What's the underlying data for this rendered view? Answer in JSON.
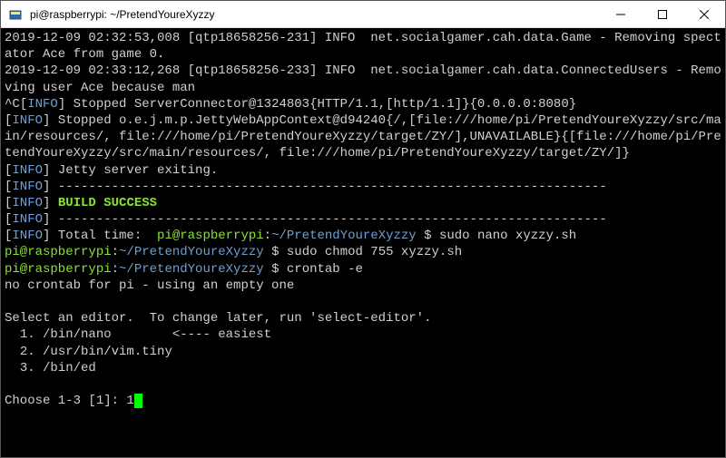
{
  "titlebar": {
    "title": "pi@raspberrypi: ~/PretendYoureXyzzy"
  },
  "term": {
    "l1": "2019-12-09 02:32:53,008 [qtp18658256-231] INFO  net.socialgamer.cah.data.Game - Removing spectator Ace from game 0.",
    "l2": "2019-12-09 02:33:12,268 [qtp18658256-233] INFO  net.socialgamer.cah.data.ConnectedUsers - Removing user Ace because man",
    "ctrlc": "^C",
    "bracket_open": "[",
    "bracket_close": "]",
    "info": "INFO",
    "stopped1": " Stopped ServerConnector@1324803{HTTP/1.1,[http/1.1]}{0.0.0.0:8080}",
    "stopped2": " Stopped o.e.j.m.p.JettyWebAppContext@d94240{/,[file:///home/pi/PretendYoureXyzzy/src/main/resources/, file:///home/pi/PretendYoureXyzzy/target/ZY/],UNAVAILABLE}{[file:///home/pi/PretendYoureXyzzy/src/main/resources/, file:///home/pi/PretendYoureXyzzy/target/ZY/]}",
    "jettyexit": " Jetty server exiting.",
    "dashes": " ------------------------------------------------------------------------",
    "buildsuccess": "BUILD SUCCESS",
    "totaltime_prefix": " Total time:  ",
    "prompt_user": "pi@raspberrypi",
    "prompt_sep": ":",
    "prompt_path": "~/PretendYoureXyzzy",
    "prompt_end": " $ ",
    "cmd1": "sudo nano xyzzy.sh",
    "cmd2": "sudo chmod 755 xyzzy.sh",
    "cmd3": "crontab -e",
    "nocrontab": "no crontab for pi - using an empty one",
    "selecteditor": "Select an editor.  To change later, run 'select-editor'.",
    "opt1": "  1. /bin/nano        <---- easiest",
    "opt2": "  2. /usr/bin/vim.tiny",
    "opt3": "  3. /bin/ed",
    "choose": "Choose 1-3 [1]: ",
    "choose_input": "1"
  }
}
